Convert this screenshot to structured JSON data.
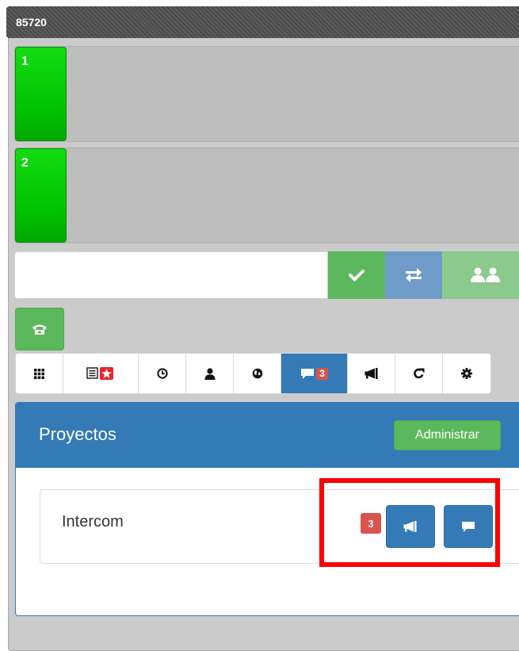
{
  "header": {
    "title": "85720"
  },
  "lines": [
    {
      "number": "1"
    },
    {
      "number": "2"
    }
  ],
  "dialer": {
    "input_value": "",
    "buttons": [
      {
        "icon": "check-icon"
      },
      {
        "icon": "transfer-arrows-icon"
      },
      {
        "icon": "conference-users-icon"
      }
    ]
  },
  "phone_button": {
    "icon": "phone-icon"
  },
  "toolbar": {
    "items": [
      {
        "icon": "keypad-grid-icon"
      },
      {
        "icon": "list-favorite-star-icon"
      },
      {
        "icon": "clock-icon"
      },
      {
        "icon": "user-icon"
      },
      {
        "icon": "globe-icon"
      },
      {
        "icon": "chat-icon",
        "badge": "3",
        "active": true
      },
      {
        "icon": "megaphone-icon"
      },
      {
        "icon": "share-redirect-icon"
      },
      {
        "icon": "gear-icon"
      }
    ]
  },
  "projects": {
    "title": "Proyectos",
    "admin_label": "Administrar",
    "items": [
      {
        "name": "Intercom",
        "badge": "3"
      }
    ]
  },
  "colors": {
    "success": "#5cb85c",
    "primary": "#337ab7",
    "danger": "#d9534f",
    "line_green": "#00c000",
    "highlight": "#ff0000"
  }
}
